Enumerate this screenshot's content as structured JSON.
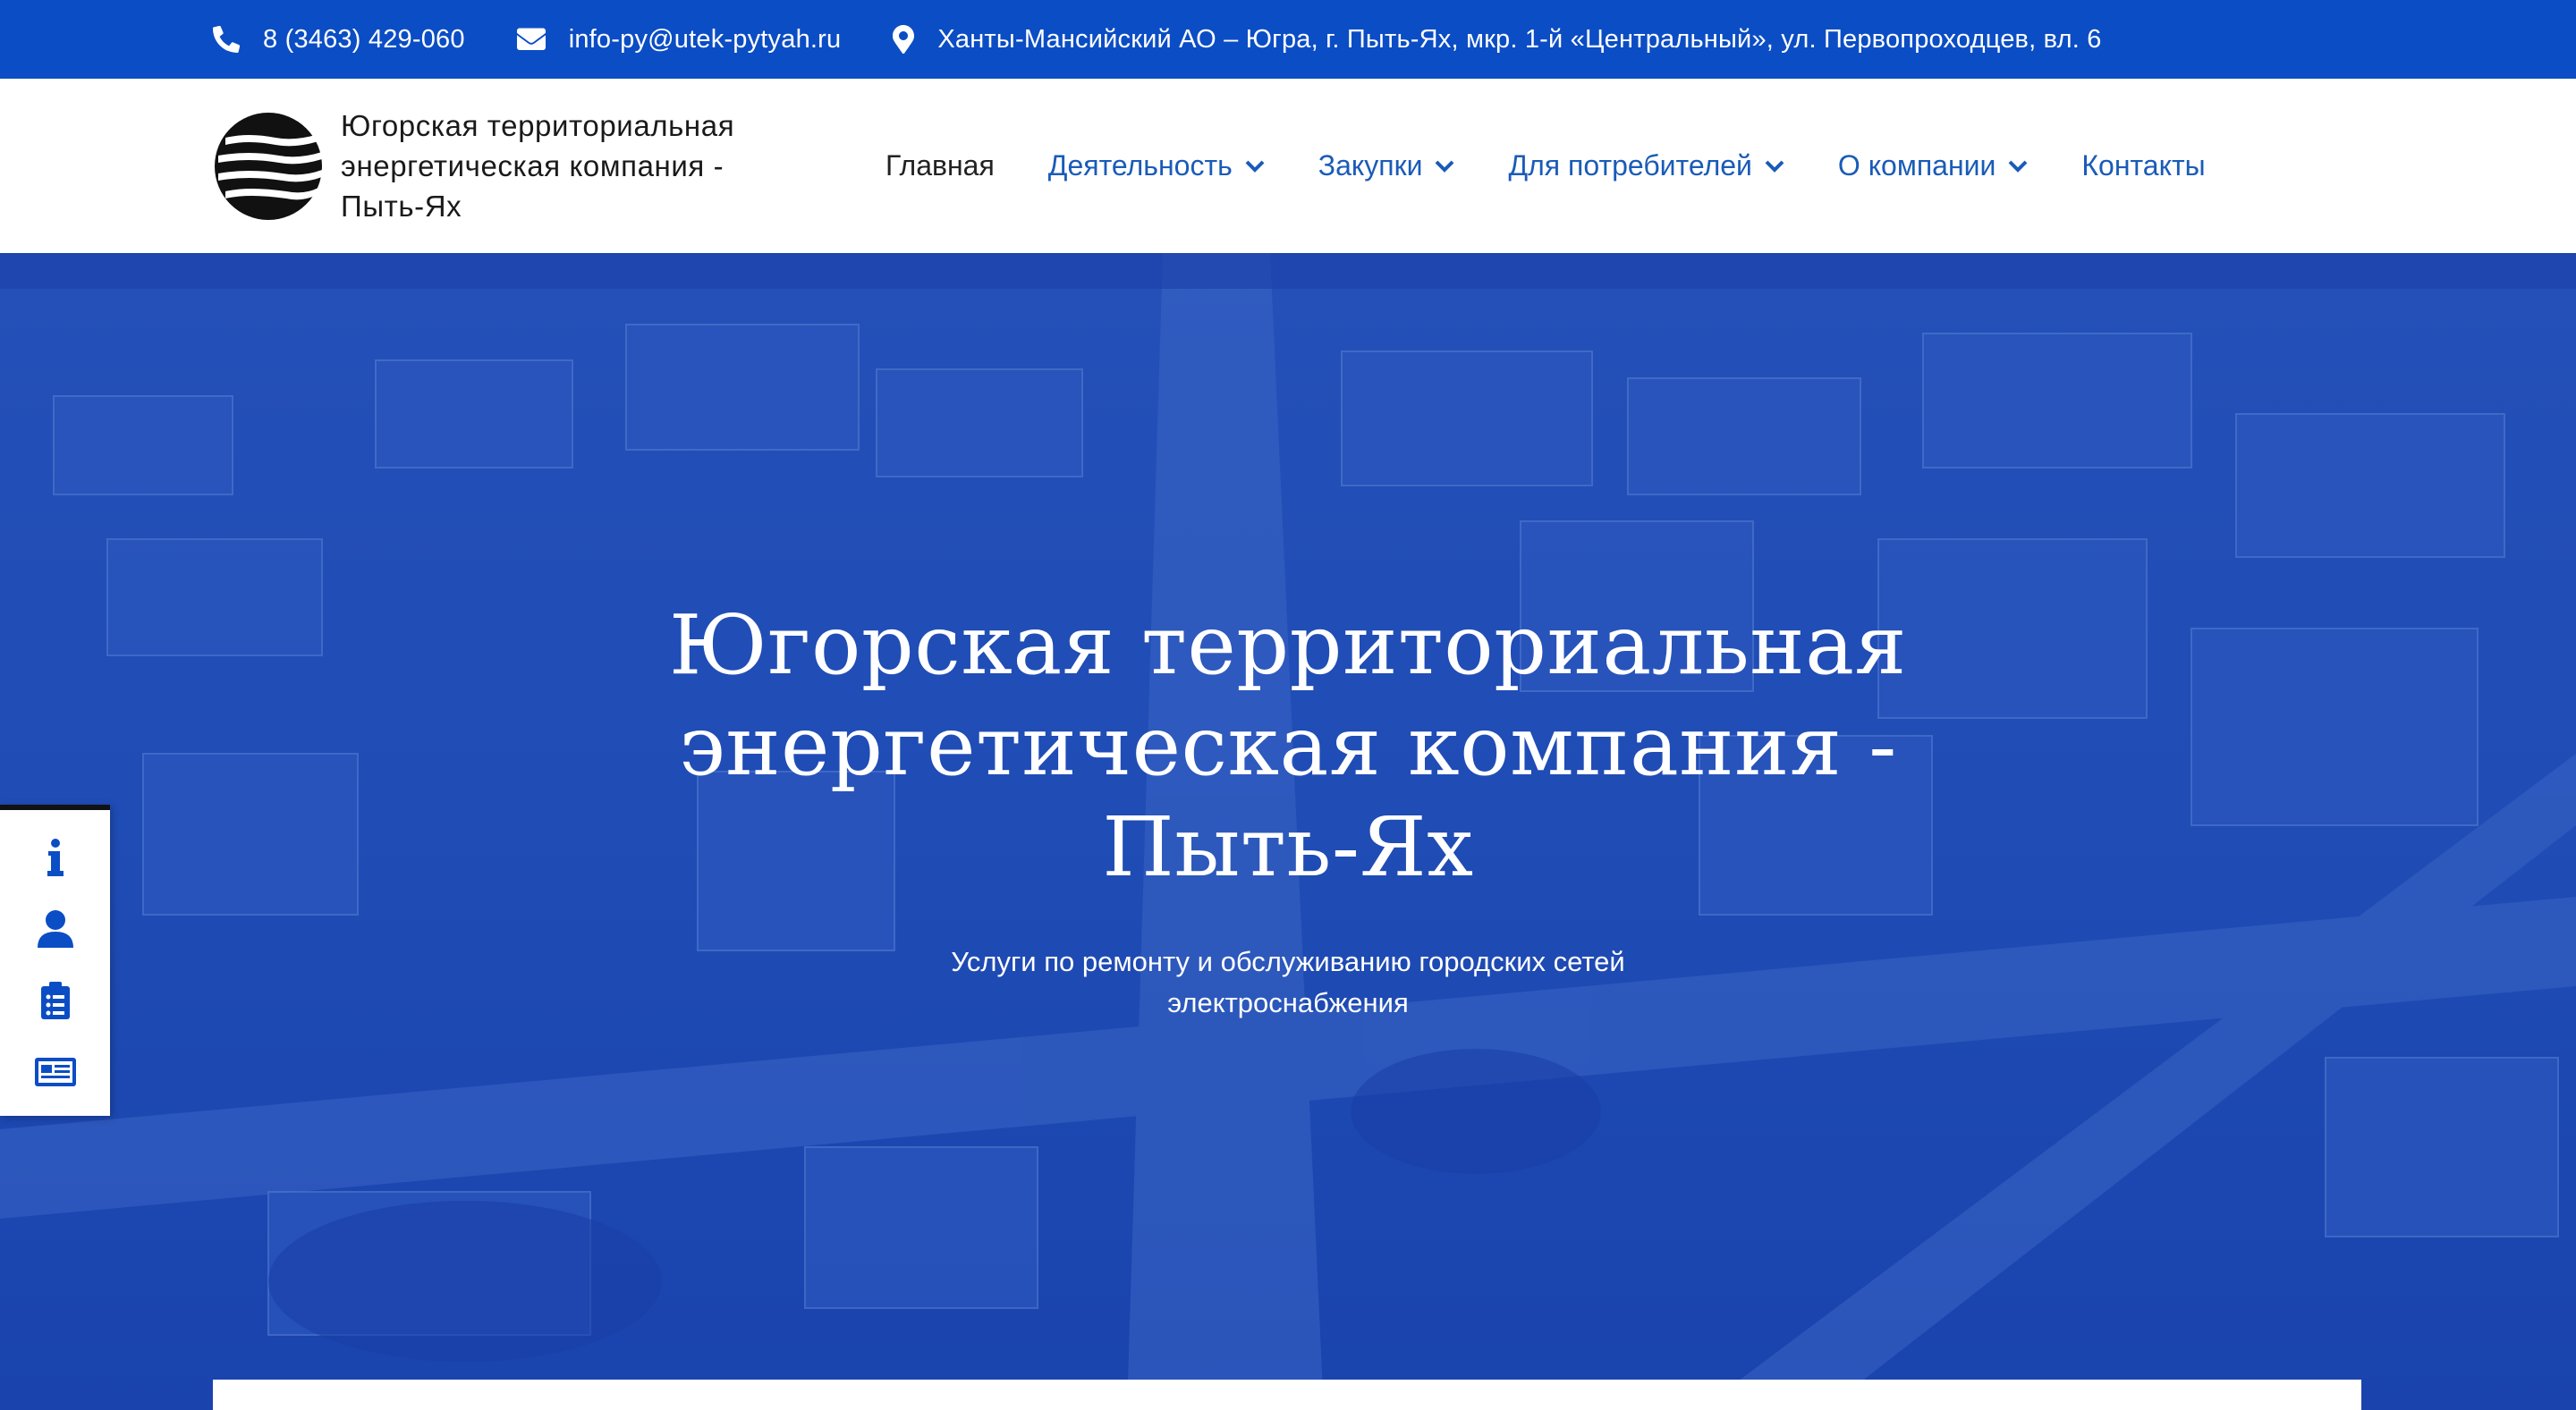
{
  "topbar": {
    "phone": "8 (3463) 429-060",
    "email": "info-py@utek-pytyah.ru",
    "address": "Ханты-Мансийский АО – Югра, г. Пыть-Ях, мкр. 1-й «Центральный», ул. Первопроходцев, вл. 6"
  },
  "header": {
    "brand_line1": "Югорская территориальная",
    "brand_line2": "энергетическая компания -",
    "brand_line3": "Пыть-Ях"
  },
  "nav": {
    "items": [
      {
        "label": "Главная",
        "dropdown": false
      },
      {
        "label": "Деятельность",
        "dropdown": true
      },
      {
        "label": "Закупки",
        "dropdown": true
      },
      {
        "label": "Для потребителей",
        "dropdown": true
      },
      {
        "label": "О компании",
        "dropdown": true
      },
      {
        "label": "Контакты",
        "dropdown": false
      }
    ]
  },
  "hero": {
    "title_line1": "Югорская территориальная",
    "title_line2": "энергетическая компания -",
    "title_line3": "Пыть-Ях",
    "subtitle_line1": "Услуги по ремонту и обслуживанию городских сетей",
    "subtitle_line2": "электроснабжения"
  },
  "side_toolbar": {
    "icons": [
      "info-icon",
      "user-icon",
      "clipboard-list-icon",
      "newspaper-icon"
    ]
  },
  "colors": {
    "brand_blue": "#0b4dc4",
    "nav_link": "#1a5bb8",
    "hero_overlay": "#1d49b5"
  }
}
